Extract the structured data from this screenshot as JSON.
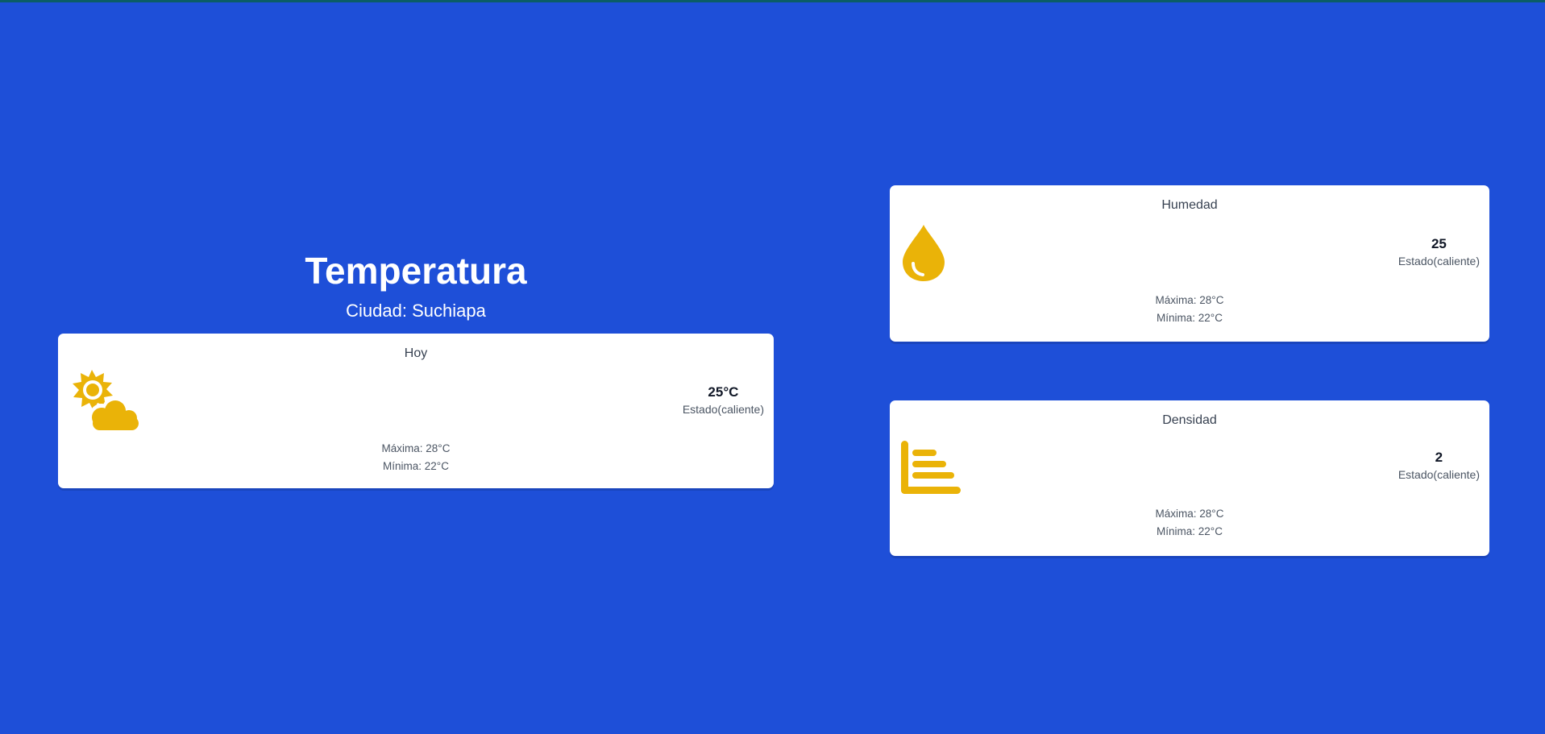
{
  "header": {
    "title": "Temperatura",
    "city": "Ciudad: Suchiapa"
  },
  "colors": {
    "background": "#1e4fd8",
    "icon": "#eab308",
    "card": "#ffffff"
  },
  "cards": {
    "today": {
      "title": "Hoy",
      "icon": "sun-cloud-icon",
      "value": "25°C",
      "status": "Estado(caliente)",
      "max": "Máxima: 28°C",
      "min": "Mínima: 22°C"
    },
    "humidity": {
      "title": "Humedad",
      "icon": "water-drop-icon",
      "value": "25",
      "status": "Estado(caliente)",
      "max": "Máxima: 28°C",
      "min": "Mínima: 22°C"
    },
    "density": {
      "title": "Densidad",
      "icon": "bar-chart-icon",
      "value": "2",
      "status": "Estado(caliente)",
      "max": "Máxima: 28°C",
      "min": "Mínima: 22°C"
    }
  }
}
